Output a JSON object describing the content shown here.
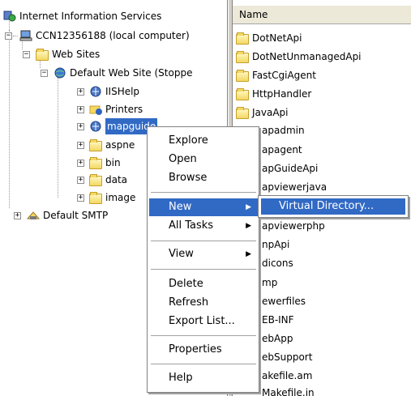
{
  "tree": {
    "root_label": "Internet Information Services",
    "computer_label": "CCN12356188 (local computer)",
    "web_sites_label": "Web Sites",
    "default_site_label": "Default Web Site (Stoppe",
    "children": [
      "IISHelp",
      "Printers",
      "mapguide",
      "aspne",
      "bin",
      "data",
      "image"
    ],
    "smtp_label": "Default SMTP"
  },
  "list": {
    "column_name": "Name",
    "items": [
      "DotNetApi",
      "DotNetUnmanagedApi",
      "FastCgiAgent",
      "HttpHandler",
      "JavaApi",
      "apadmin",
      "apagent",
      "apGuideApi",
      "apviewerjava",
      "",
      "apviewerphp",
      "npApi",
      "dicons",
      "mp",
      "ewerfiles",
      "EB-INF",
      "ebApp",
      "ebSupport",
      "akefile.am",
      "Makefile.in"
    ]
  },
  "context_menu": {
    "items": [
      "Explore",
      "Open",
      "Browse",
      "New",
      "All Tasks",
      "View",
      "Delete",
      "Refresh",
      "Export List...",
      "Properties",
      "Help"
    ]
  },
  "submenu": {
    "item": "Virtual Directory..."
  },
  "colors": {
    "selection": "#316ac5",
    "menu_bg": "#ffffff",
    "header_bg": "#ece9d8"
  }
}
